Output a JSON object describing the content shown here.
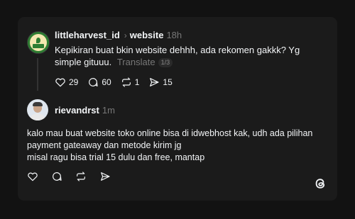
{
  "post": {
    "username": "littleharvest_id",
    "chevron": "›",
    "topic": "website",
    "time": "18h",
    "text": "Kepikiran buat bkin website dehhh, ada rekomen gakkk? Yg simple gituuu.",
    "translate_label": "Translate",
    "translate_page": "1/3",
    "likes": "29",
    "comments": "60",
    "reposts": "1",
    "shares": "15"
  },
  "reply": {
    "username": "rievandrst",
    "time": "1m",
    "lines": [
      "kalo mau buat website toko online bisa di idwebhost kak, udh ada pilihan",
      "payment gateaway dan metode kirim jg",
      "misal ragu bisa trial 15 dulu dan free, mantap"
    ]
  },
  "icons": {
    "like": "heart-icon",
    "comment": "comment-icon",
    "repost": "repost-icon",
    "share": "send-icon",
    "logo": "threads-logo-icon"
  },
  "colors": {
    "background": "#121212",
    "card": "#1b1b1b",
    "text": "#f3f5f7",
    "muted": "#777777"
  }
}
